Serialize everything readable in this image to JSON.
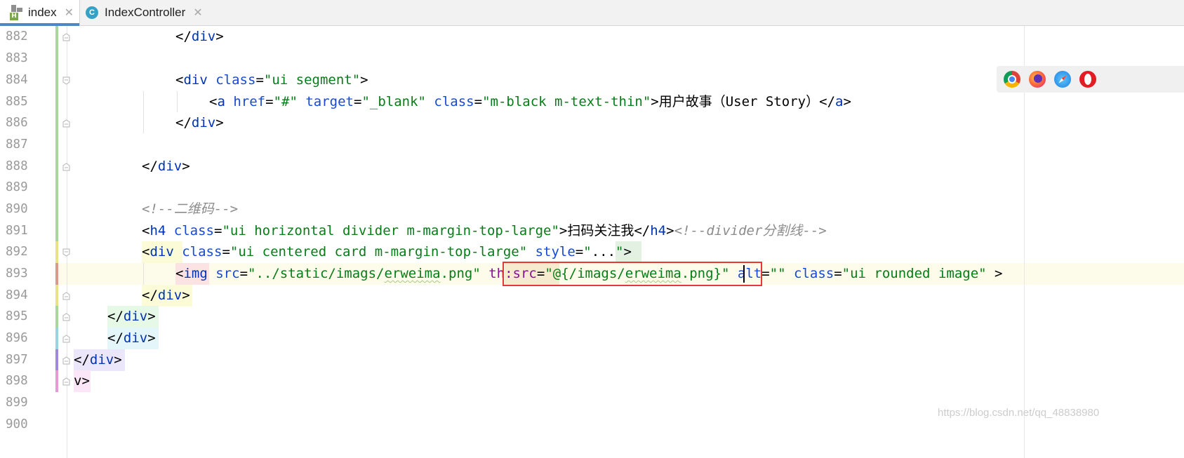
{
  "tabs": [
    {
      "label": "index",
      "icon": "html-file-icon",
      "active": true
    },
    {
      "label": "IndexController",
      "icon": "java-class-icon",
      "active": false
    }
  ],
  "tab_close_glyph": "✕",
  "line_numbers": [
    "882",
    "883",
    "884",
    "885",
    "886",
    "887",
    "888",
    "889",
    "890",
    "891",
    "892",
    "893",
    "894",
    "895",
    "896",
    "897",
    "898",
    "899",
    "900"
  ],
  "code": {
    "l882": {
      "open": "</",
      "tag": "div",
      "close": ">"
    },
    "l884": {
      "open": "<",
      "tag": "div",
      "attr": "class",
      "eq": "=",
      "val": "\"ui segment\"",
      "close": ">"
    },
    "l885": {
      "open": "<",
      "tag": "a",
      "a1": "href",
      "v1": "\"#\"",
      "a2": "target",
      "v2": "\"_blank\"",
      "a3": "class",
      "v3": "\"m-black m-text-thin\"",
      "text": ">用户故事（User Story）</",
      "tag_end": "a",
      "close": ">"
    },
    "l886": {
      "open": "</",
      "tag": "div",
      "close": ">"
    },
    "l888": {
      "open": "</",
      "tag": "div",
      "close": ">"
    },
    "l890": {
      "comment": "<!--二维码-->"
    },
    "l891": {
      "open": "<",
      "tag": "h4",
      "attr": "class",
      "val": "\"ui horizontal divider m-margin-top-large\"",
      "text": ">扫码关注我</",
      "tag_end": "h4",
      "close": ">",
      "comment": "<!--divider分割线-->"
    },
    "l892": {
      "open": "<",
      "tag": "div",
      "a1": "class",
      "v1": "\"ui centered card m-margin-top-large\"",
      "a2": "style",
      "v2a": "\"",
      "v2b": "...",
      "v2c": "\"",
      "close": ">"
    },
    "l893": {
      "open": "<",
      "tag": "img",
      "a1": "src",
      "v1a": "\"../static/imags/",
      "v1b": "erweima",
      "v1c": ".png\"",
      "a2": "th:src",
      "v2a": "\"@{/imags/",
      "v2b": "erweima",
      "v2c": ".png",
      "v2d": "}\"",
      "a3": "alt",
      "v3": "\"\"",
      "a4": "class",
      "v4": "\"ui rounded image\"",
      "close": " >"
    },
    "l894": {
      "open": "</",
      "tag": "div",
      "close": ">"
    },
    "l895": {
      "open": "</",
      "tag": "div",
      "close": ">"
    },
    "l896": {
      "open": "</",
      "tag": "div",
      "close": ">"
    },
    "l897": {
      "open": "</",
      "tag": "div",
      "close": ">"
    },
    "l898": {
      "text": "v>"
    }
  },
  "browser_icons": [
    "chrome-icon",
    "firefox-icon",
    "safari-icon",
    "opera-icon"
  ],
  "watermark": "https://blog.csdn.net/qq_48838980",
  "colors": {
    "tag": "#0033b3",
    "attr": "#174ad4",
    "string": "#067d17",
    "comment": "#8c8c8c",
    "highlight_box": "#e53935",
    "tab_accent": "#4a88c7"
  }
}
